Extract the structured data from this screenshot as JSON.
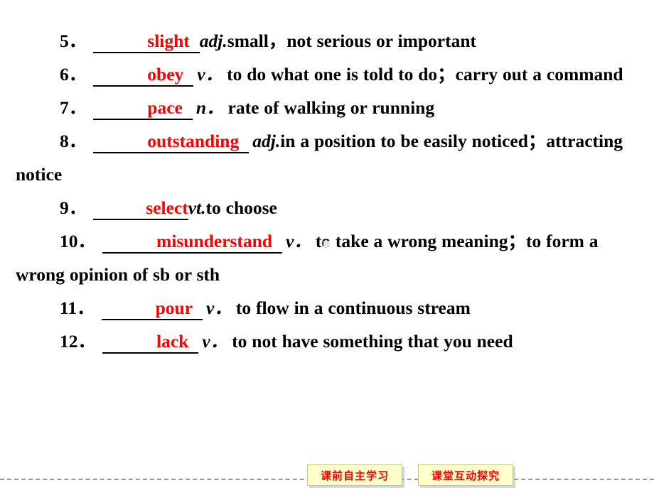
{
  "slide": {
    "background_color": "#ffffff",
    "answer_color": "#ff0000",
    "text_color": "#000000"
  },
  "vocab_list": [
    {
      "number": "5．",
      "answer": "slight",
      "pos": "adj.",
      "definition": "small，not serious or important"
    },
    {
      "number": "6．",
      "answer": "obey",
      "pos": "v．",
      "definition": "to do what one is told to do；carry out a command"
    },
    {
      "number": "7．",
      "answer": "pace",
      "pos": "n．",
      "definition": "rate of walking or running"
    },
    {
      "number": "8．",
      "answer": "outstanding",
      "pos": "adj.",
      "definition": "in a position to be easily noticed；attracting notice"
    },
    {
      "number": "9．",
      "answer": "select",
      "pos": "vt.",
      "definition": "to choose"
    },
    {
      "number": "10．",
      "answer": "misunderstand",
      "pos": "v．",
      "definition": "to take a wrong meaning；to form a wrong opinion of sb or sth"
    },
    {
      "number": "11．",
      "answer": "pour",
      "pos": "v．",
      "definition": "to flow in a continuous stream"
    },
    {
      "number": "12．",
      "answer": "lack",
      "pos": "v．",
      "definition": "to not have something that you need"
    }
  ],
  "footer": {
    "chips": [
      {
        "label": "课前自主学习"
      },
      {
        "label": "课堂互动探究"
      }
    ],
    "chip_background": "#ffffcc",
    "chip_text_color": "#ff0000",
    "rule_color": "#9a9a9a"
  }
}
